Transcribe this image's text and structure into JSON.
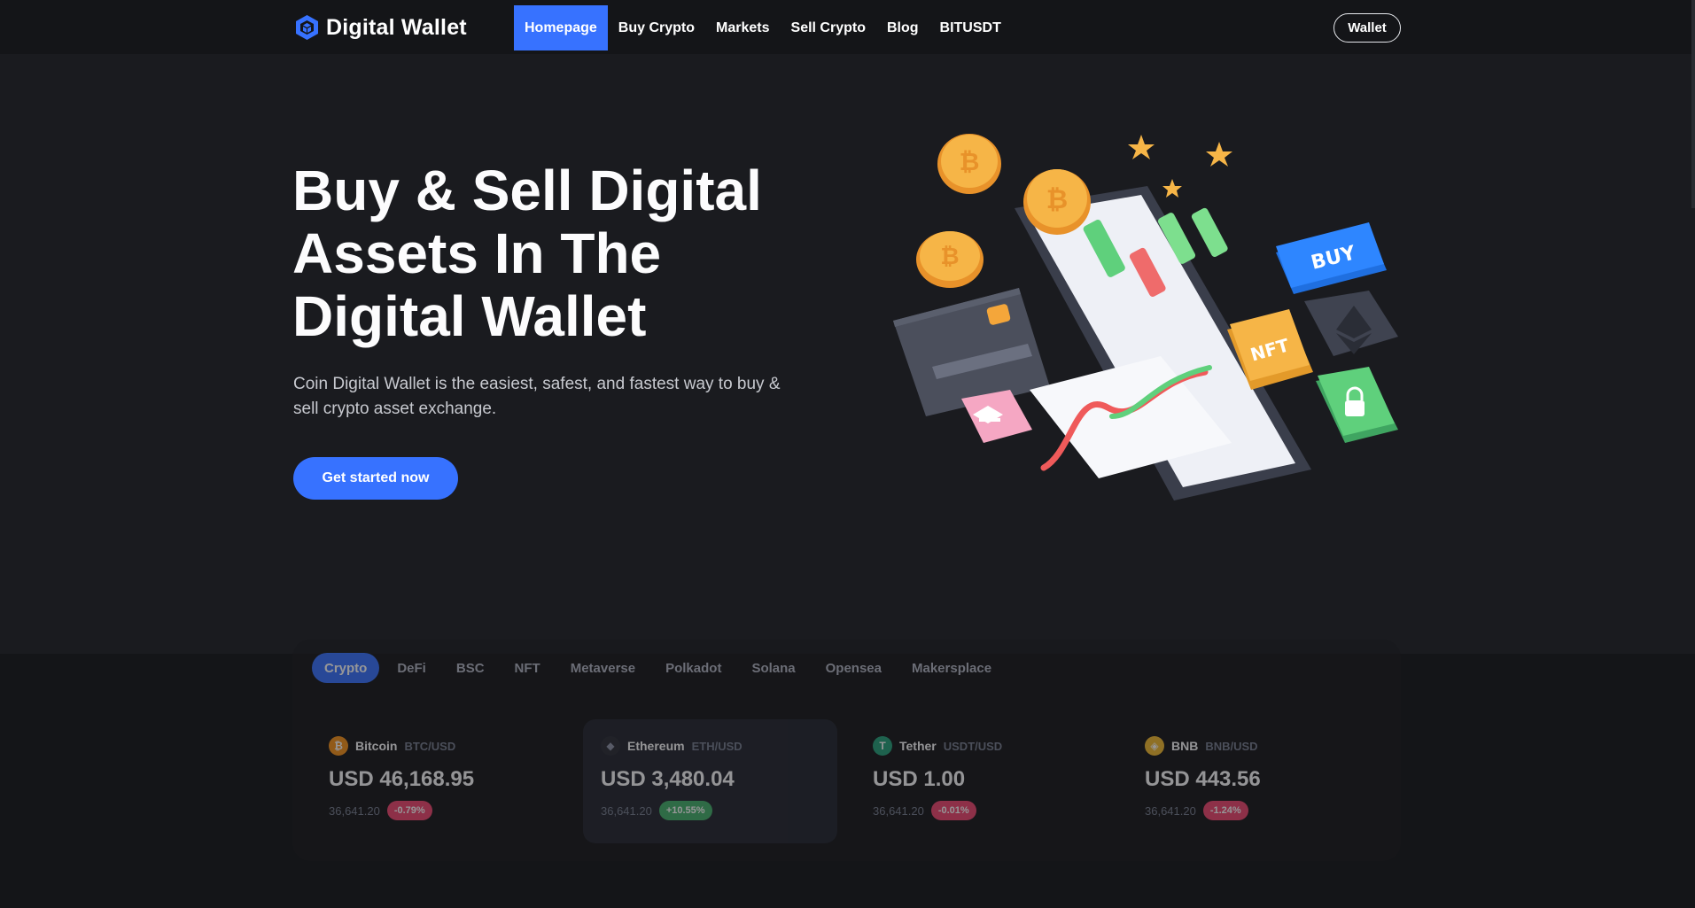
{
  "brand": {
    "name": "Digital Wallet",
    "accent": "#3772ff"
  },
  "nav": {
    "items": [
      {
        "label": "Homepage",
        "active": true
      },
      {
        "label": "Buy Crypto"
      },
      {
        "label": "Markets"
      },
      {
        "label": "Sell Crypto"
      },
      {
        "label": "Blog"
      },
      {
        "label": "BITUSDT"
      }
    ],
    "wallet_label": "Wallet"
  },
  "hero": {
    "title_line1": "Buy & Sell Digital",
    "title_line2": "Assets In The",
    "title_line3": "Digital Wallet",
    "description": "Coin Digital Wallet is the easiest, safest, and fastest way to buy & sell crypto asset exchange.",
    "cta_label": "Get started now",
    "illustration_labels": {
      "buy": "BUY",
      "nft": "NFT"
    }
  },
  "market": {
    "tabs": [
      "Crypto",
      "DeFi",
      "BSC",
      "NFT",
      "Metaverse",
      "Polkadot",
      "Solana",
      "Opensea",
      "Makersplace"
    ],
    "active_tab": "Crypto",
    "coins": [
      {
        "name": "Bitcoin",
        "pair": "BTC/USD",
        "price": "USD 46,168.95",
        "volume": "36,641.20",
        "change": "-0.79%",
        "direction": "down",
        "icon": "bitcoin-icon",
        "color": "#f7931a"
      },
      {
        "name": "Ethereum",
        "pair": "ETH/USD",
        "price": "USD 3,480.04",
        "volume": "36,641.20",
        "change": "+10.55%",
        "direction": "up",
        "icon": "ethereum-icon",
        "color": "#627eea"
      },
      {
        "name": "Tether",
        "pair": "USDT/USD",
        "price": "USD 1.00",
        "volume": "36,641.20",
        "change": "-0.01%",
        "direction": "down",
        "icon": "tether-icon",
        "color": "#26a17b"
      },
      {
        "name": "BNB",
        "pair": "BNB/USD",
        "price": "USD 443.56",
        "volume": "36,641.20",
        "change": "-1.24%",
        "direction": "down",
        "icon": "bnb-icon",
        "color": "#f3ba2f"
      }
    ]
  }
}
